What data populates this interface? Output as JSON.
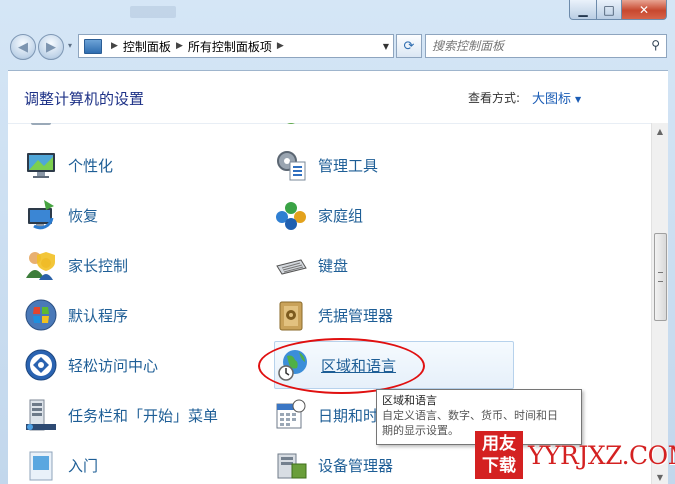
{
  "window": {
    "caption": {
      "min": "▁",
      "max": "□",
      "close": "✕"
    }
  },
  "nav": {
    "back_glyph": "◀",
    "forward_glyph": "▶",
    "history_glyph": "▾",
    "address": {
      "crumb1": "控制面板",
      "crumb2": "所有控制面板项",
      "separator": "▶",
      "dropdown_glyph": "▼"
    },
    "refresh_glyph": "⟳",
    "search": {
      "placeholder": "搜索控制面板",
      "icon_glyph": "⚲"
    }
  },
  "header": {
    "title": "调整计算机的设置",
    "view_by_label": "查看方式:",
    "view_by_value": "大图标",
    "view_by_arrow": "▼"
  },
  "items": [
    {
      "label": "个性化",
      "icon": "personalization-icon"
    },
    {
      "label": "管理工具",
      "icon": "administrative-tools-icon"
    },
    {
      "label": "恢复",
      "icon": "recovery-icon"
    },
    {
      "label": "家庭组",
      "icon": "homegroup-icon"
    },
    {
      "label": "家长控制",
      "icon": "parental-controls-icon"
    },
    {
      "label": "键盘",
      "icon": "keyboard-icon"
    },
    {
      "label": "默认程序",
      "icon": "default-programs-icon"
    },
    {
      "label": "凭据管理器",
      "icon": "credential-manager-icon"
    },
    {
      "label": "轻松访问中心",
      "icon": "ease-of-access-icon"
    },
    {
      "label": "区域和语言",
      "icon": "region-language-icon"
    },
    {
      "label": "任务栏和「开始」菜单",
      "icon": "taskbar-start-menu-icon"
    },
    {
      "label": "日期和时",
      "icon": "date-time-icon"
    },
    {
      "label": "入门",
      "icon": "getting-started-icon"
    },
    {
      "label": "设备管理器",
      "icon": "device-manager-icon"
    }
  ],
  "scrollbar": {
    "up_glyph": "▲",
    "down_glyph": "▼"
  },
  "tooltip": {
    "title": "区域和语言",
    "line1": "自定义语言、数字、货币、时间和日",
    "line2": "期的显示设置。"
  },
  "watermark": {
    "block_chars": "用友下载",
    "url": "YYRJXZ.COM"
  }
}
